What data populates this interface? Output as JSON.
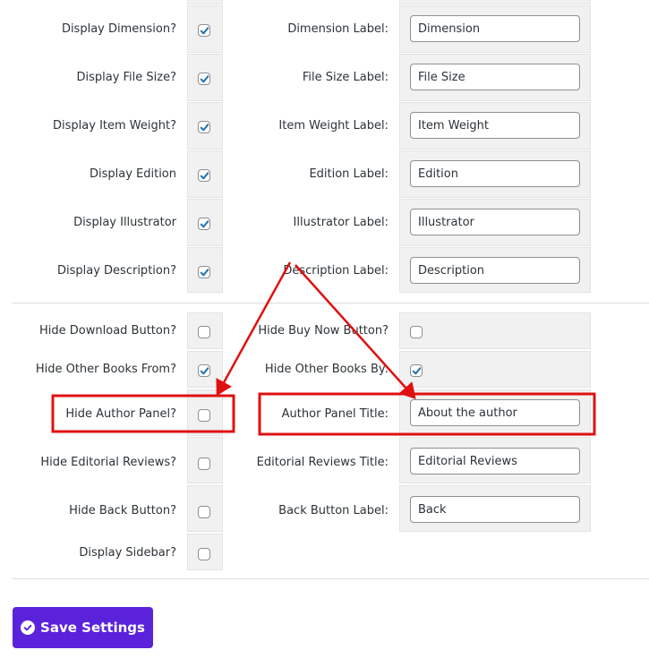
{
  "colors": {
    "accent": "#5b22dc",
    "checkmark": "#2271b1",
    "annotation": "#e01010",
    "cell_bg": "#f1f1f1"
  },
  "display_section": {
    "rows": [
      {
        "toggle_label": "Display Dimension?",
        "checked": true,
        "field_label": "Dimension Label:",
        "field_value": "Dimension"
      },
      {
        "toggle_label": "Display File Size?",
        "checked": true,
        "field_label": "File Size Label:",
        "field_value": "File Size"
      },
      {
        "toggle_label": "Display Item Weight?",
        "checked": true,
        "field_label": "Item Weight Label:",
        "field_value": "Item Weight"
      },
      {
        "toggle_label": "Display Edition",
        "checked": true,
        "field_label": "Edition Label:",
        "field_value": "Edition"
      },
      {
        "toggle_label": "Display Illustrator",
        "checked": true,
        "field_label": "Illustrator Label:",
        "field_value": "Illustrator"
      },
      {
        "toggle_label": "Display Description?",
        "checked": true,
        "field_label": "Description Label:",
        "field_value": "Description"
      }
    ]
  },
  "hide_section": {
    "rows": [
      {
        "left_label": "Hide Download Button?",
        "left_checked": false,
        "right_label": "Hide Buy Now Button?",
        "right_type": "checkbox",
        "right_checked": false
      },
      {
        "left_label": "Hide Other Books From?",
        "left_checked": true,
        "right_label": "Hide Other Books By:",
        "right_type": "checkbox",
        "right_checked": true
      },
      {
        "left_label": "Hide Author Panel?",
        "left_checked": false,
        "right_label": "Author Panel Title:",
        "right_type": "text",
        "right_value": "About the author",
        "highlighted": true
      },
      {
        "left_label": "Hide Editorial Reviews?",
        "left_checked": false,
        "right_label": "Editorial Reviews Title:",
        "right_type": "text",
        "right_value": "Editorial Reviews"
      },
      {
        "left_label": "Hide Back Button?",
        "left_checked": false,
        "right_label": "Back Button Label:",
        "right_type": "text",
        "right_value": "Back"
      },
      {
        "left_label": "Display Sidebar?",
        "left_checked": false
      }
    ]
  },
  "save_button": {
    "label": "Save Settings",
    "icon": "check-circle-icon"
  },
  "annotations": {
    "highlight_boxes": [
      "hide-author-panel-row",
      "author-panel-title-row"
    ],
    "arrows": [
      "arrow-to-hide-author-panel-checkbox",
      "arrow-to-author-panel-title-input"
    ]
  }
}
